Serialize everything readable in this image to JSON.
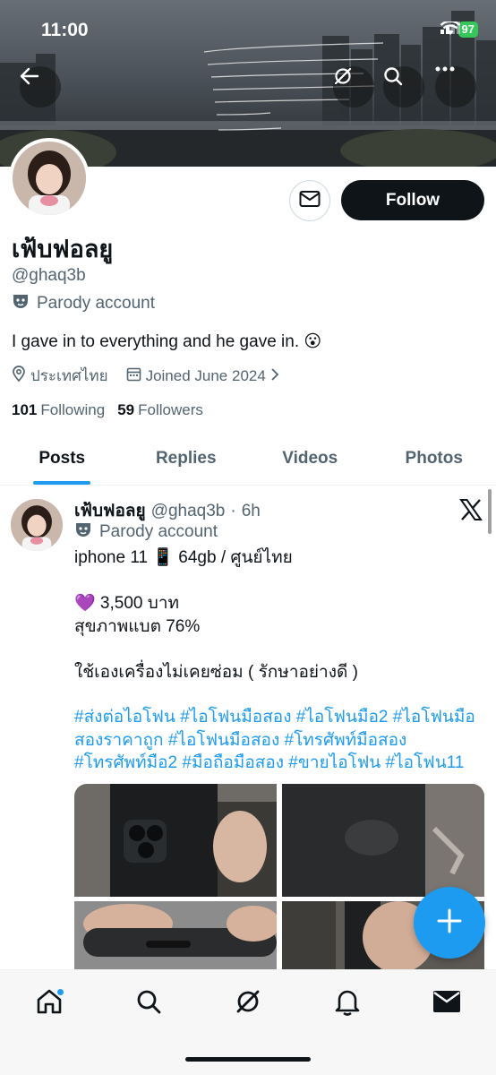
{
  "status_bar": {
    "time": "11:00",
    "battery": "97"
  },
  "profile": {
    "display_name": "เฟ้บฟอลยู",
    "handle": "@ghaq3b",
    "parody_label": "Parody account",
    "bio": "I gave in to everything and he gave in. 😮",
    "location": "ประเทศไทย",
    "joined": "Joined June 2024",
    "following_count": "101",
    "following_label": "Following",
    "followers_count": "59",
    "followers_label": "Followers",
    "follow_label": "Follow"
  },
  "tabs": [
    {
      "label": "Posts",
      "active": true
    },
    {
      "label": "Replies",
      "active": false
    },
    {
      "label": "Videos",
      "active": false
    },
    {
      "label": "Photos",
      "active": false
    }
  ],
  "post": {
    "name": "เฟ้บฟอลยู",
    "handle": "@ghaq3b",
    "separator": "·",
    "time": "6h",
    "parody_label": "Parody account",
    "lines": [
      "iphone 11 📱 64gb / ศูนย์ไทย",
      "",
      "💜 3,500 บาท",
      "สุขภาพแบต 76%",
      "",
      "ใช้เองเครื่องไม่เคยซ่อม ( รักษาอย่างดี )"
    ],
    "hashtag_lines": [
      "#ส่งต่อไอโฟน #ไอโฟนมือสอง #ไอโฟนมือ2 #ไอโฟนมือ",
      "สองราคาถูก  #ไอโฟนมือสอง #โทรศัพท์มือสอง",
      "#โทรศัพท์มือ2 #มือถือมือสอง #ขายไอโฟน #ไอโฟน11"
    ]
  },
  "colors": {
    "accent": "#1d9bf0",
    "text": "#0f1419",
    "muted": "#536471"
  },
  "icons": {
    "back": "arrow-left-icon",
    "grok": "grok-icon",
    "search": "search-icon",
    "more": "more-icon",
    "mail": "mail-icon",
    "nav": [
      "home-icon",
      "search-icon",
      "grok-icon",
      "bell-icon",
      "envelope-icon"
    ]
  }
}
